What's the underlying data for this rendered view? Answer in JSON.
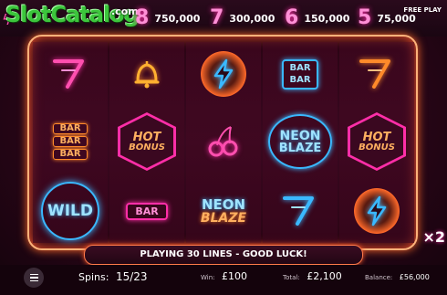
{
  "watermark": {
    "name": "SlotCatalog",
    "suffix": ".com"
  },
  "paytable": [
    {
      "symbol": "8",
      "value": "750,000"
    },
    {
      "symbol": "7",
      "value": "300,000"
    },
    {
      "symbol": "6",
      "value": "150,000"
    },
    {
      "symbol": "5",
      "value": "75,000"
    }
  ],
  "free_play_label": "FREE PLAY",
  "reels": [
    [
      "seven-icon",
      "bar-triple",
      "wild"
    ],
    [
      "bell-icon",
      "hot-bonus",
      "bar-single"
    ],
    [
      "lightning-icon",
      "cherry-icon",
      "neon-blaze"
    ],
    [
      "bar-double",
      "neon-blaze",
      "seven-icon"
    ],
    [
      "seven-icon",
      "hot-bonus",
      "lightning-icon"
    ]
  ],
  "symbol_text": {
    "bar": "BAR",
    "hot": "HOT",
    "bonus": "BONUS",
    "neon": "NEON",
    "blaze": "BLAZE",
    "wild": "WILD"
  },
  "message": "PLAYING 30 LINES - GOOD LUCK!",
  "bottom": {
    "spins_label": "Spins:",
    "spins_value": "15/23",
    "win_label": "Win:",
    "win_value": "£100",
    "total_label": "Total:",
    "total_value": "£2,100",
    "balance_label": "Balance:",
    "balance_value": "£56,000"
  },
  "multiplier": "×2",
  "colors": {
    "pink": "#ff2ea8",
    "orange": "#ff8a2a",
    "blue": "#3ab8ff",
    "frame": "#ffb27a"
  }
}
